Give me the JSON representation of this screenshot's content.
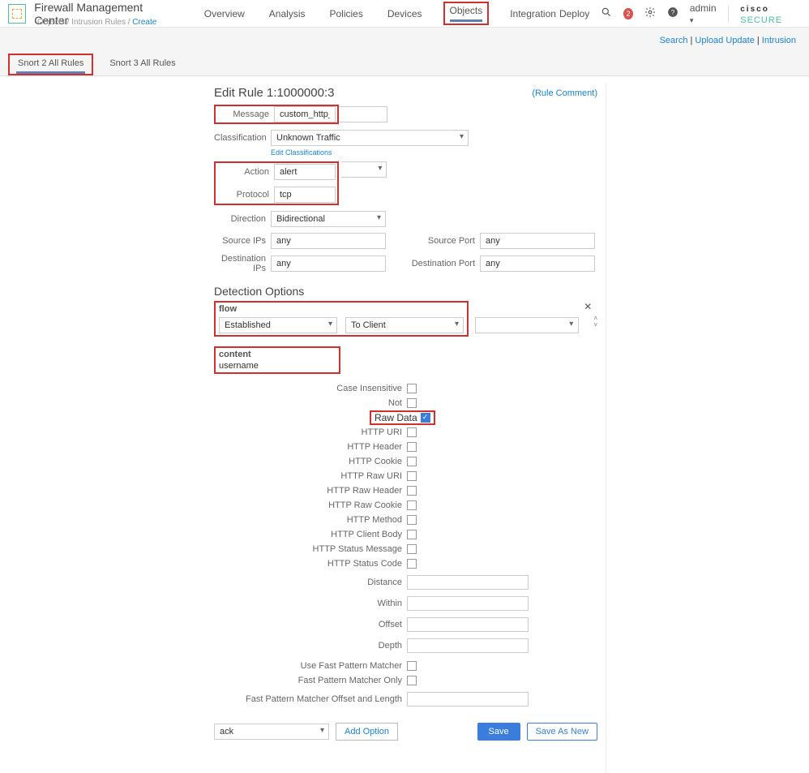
{
  "header": {
    "app_title": "Firewall Management Center",
    "breadcrumb": {
      "p1": "Objects",
      "p2": "Intrusion Rules",
      "p3": "Create"
    },
    "nav": [
      "Overview",
      "Analysis",
      "Policies",
      "Devices",
      "Objects",
      "Integration"
    ],
    "nav_active": "Objects",
    "deploy": "Deploy",
    "notif_count": "2",
    "admin": "admin",
    "brand1": "cisco",
    "brand2": "SECURE"
  },
  "sublinks": {
    "a": "Search",
    "b": "Upload Update",
    "c": "Intrusion"
  },
  "tabs2": {
    "a": "Snort 2 All Rules",
    "b": "Snort 3 All Rules"
  },
  "panel": {
    "title": "Edit Rule 1:1000000:3",
    "rule_comment": "(Rule Comment)",
    "labels": {
      "message": "Message",
      "classification": "Classification",
      "edit_class": "Edit Classifications",
      "action": "Action",
      "protocol": "Protocol",
      "direction": "Direction",
      "srcips": "Source IPs",
      "srcport": "Source Port",
      "dstips": "Destination IPs",
      "dstport": "Destination Port"
    },
    "values": {
      "message": "custom_http_sig",
      "classification": "Unknown Traffic",
      "action": "alert",
      "protocol": "tcp",
      "direction": "Bidirectional",
      "srcips": "any",
      "srcport": "any",
      "dstips": "any",
      "dstport": "any"
    }
  },
  "detection": {
    "section": "Detection Options",
    "flow": {
      "label": "flow",
      "v1": "Established",
      "v2": "To Client"
    },
    "content": {
      "label": "content",
      "value": "username"
    },
    "checkboxes": [
      {
        "label": "Case Insensitive",
        "checked": false
      },
      {
        "label": "Not",
        "checked": false
      },
      {
        "label": "Raw Data",
        "checked": true
      },
      {
        "label": "HTTP URI",
        "checked": false
      },
      {
        "label": "HTTP Header",
        "checked": false
      },
      {
        "label": "HTTP Cookie",
        "checked": false
      },
      {
        "label": "HTTP Raw URI",
        "checked": false
      },
      {
        "label": "HTTP Raw Header",
        "checked": false
      },
      {
        "label": "HTTP Raw Cookie",
        "checked": false
      },
      {
        "label": "HTTP Method",
        "checked": false
      },
      {
        "label": "HTTP Client Body",
        "checked": false
      },
      {
        "label": "HTTP Status Message",
        "checked": false
      },
      {
        "label": "HTTP Status Code",
        "checked": false
      }
    ],
    "textfields": [
      "Distance",
      "Within",
      "Offset",
      "Depth"
    ],
    "extra_checks": [
      "Use Fast Pattern Matcher",
      "Fast Pattern Matcher Only"
    ],
    "fpm_offset": "Fast Pattern Matcher Offset and Length",
    "bottom": {
      "sel": "ack",
      "add": "Add Option",
      "save": "Save",
      "save_new": "Save As New"
    }
  }
}
